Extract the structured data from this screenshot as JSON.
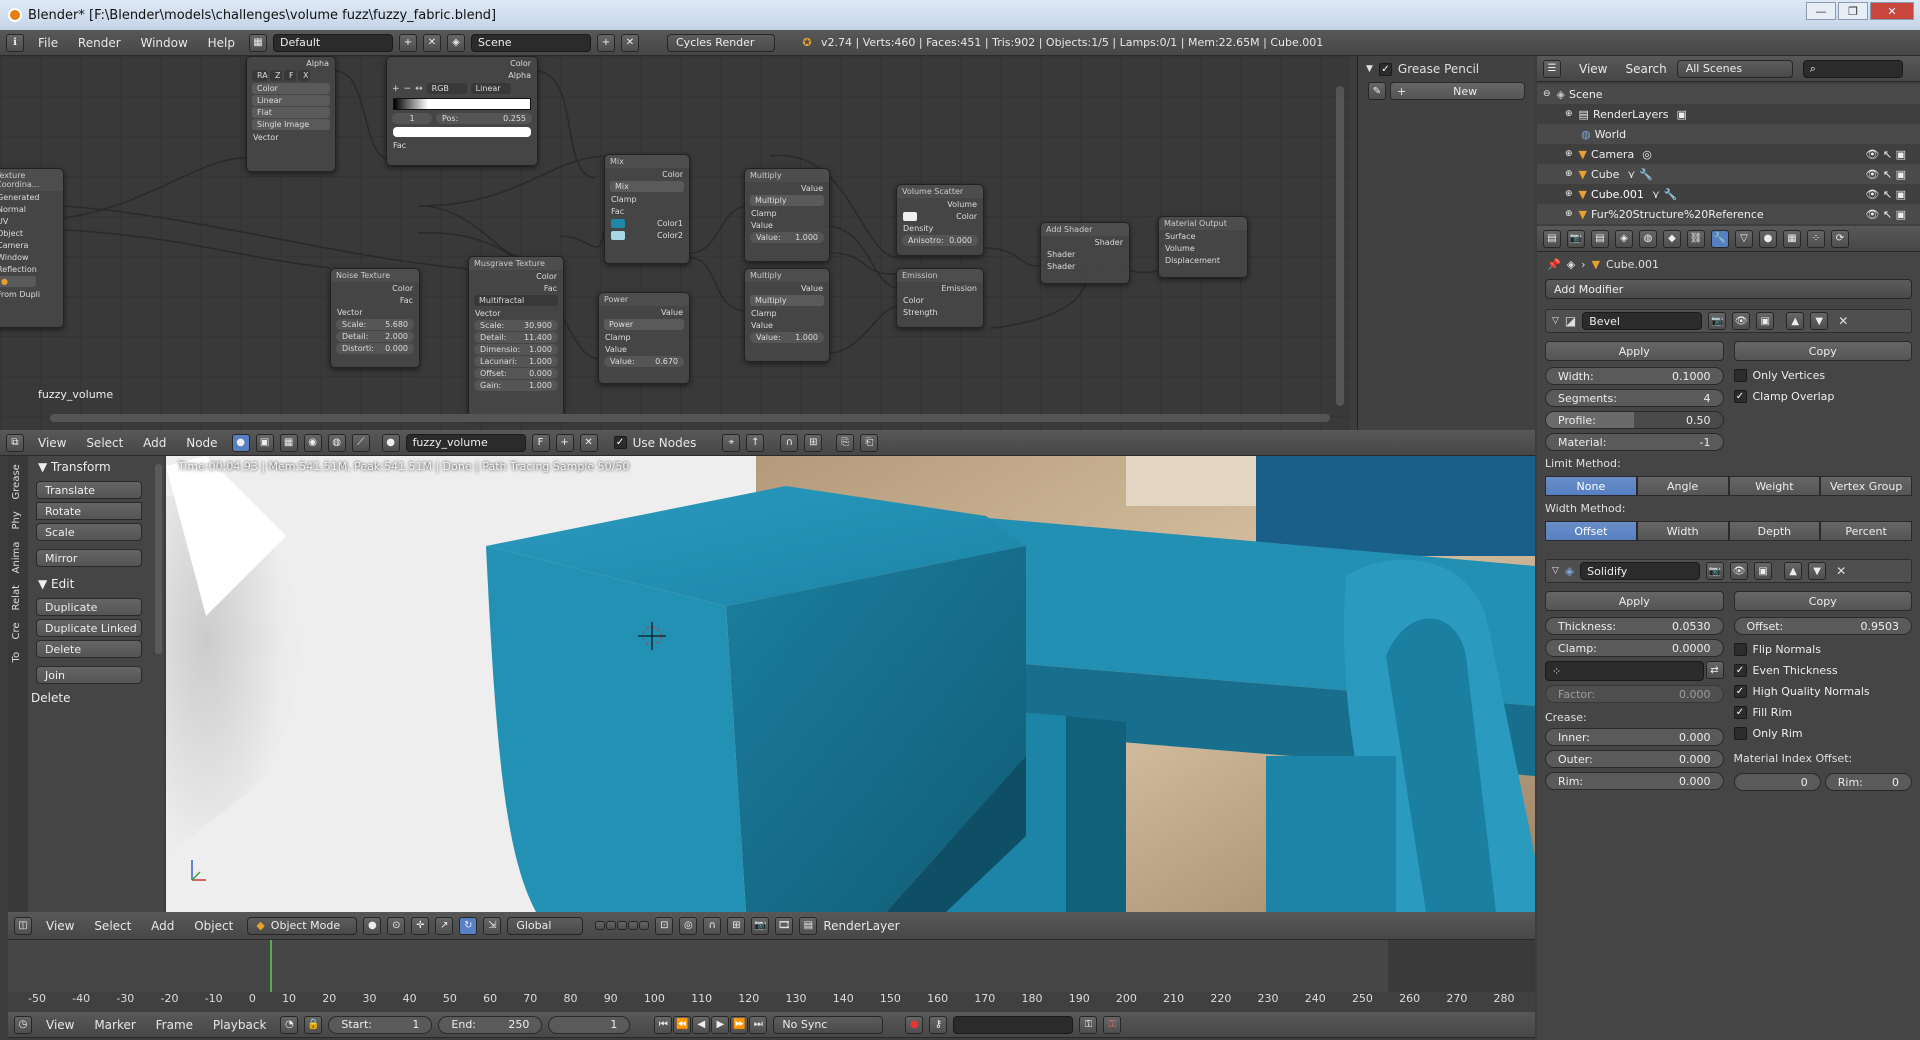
{
  "window": {
    "title": "Blender* [F:\\Blender\\models\\challenges\\volume fuzz\\fuzzy_fabric.blend]",
    "controls": [
      "—",
      "❐",
      "✕"
    ]
  },
  "topbar": {
    "menus": [
      "File",
      "Render",
      "Window",
      "Help"
    ],
    "layout": "Default",
    "scene": "Scene",
    "engine": "Cycles Render",
    "stats": "v2.74 | Verts:460 | Faces:451 | Tris:902 | Objects:1/5 | Lamps:0/1 | Mem:22.65M | Cube.001"
  },
  "node_editor": {
    "material_name": "fuzzy_volume",
    "tex_coord": {
      "title": "Texture Coordina...",
      "outputs": [
        "Generated",
        "Normal",
        "UV",
        "Object",
        "Camera",
        "Window",
        "Reflection"
      ],
      "from_dupli": "From Dupli"
    },
    "image_tex": {
      "outputs": [
        "Alpha",
        "Vector"
      ],
      "mode_buttons": [
        "RA",
        "Z",
        "F",
        "X"
      ],
      "color": "Color",
      "interp": "Linear",
      "proj": "Flat",
      "source": "Single Image"
    },
    "color_ramp": {
      "outputs": [
        "Color",
        "Alpha"
      ],
      "rgb": "RGB",
      "linear": "Linear",
      "index": "1",
      "pos": "Pos:",
      "pos_val": "0.255",
      "fac": "Fac"
    },
    "noise": {
      "title": "Noise Texture",
      "outputs": [
        "Color",
        "Fac"
      ],
      "vector": "Vector",
      "scale": "Scale:",
      "scale_v": "5.680",
      "detail": "Detail:",
      "detail_v": "2.000",
      "distort": "Distorti:",
      "distort_v": "0.000"
    },
    "musgrave": {
      "title": "Musgrave Texture",
      "outputs": [
        "Color",
        "Fac"
      ],
      "type": "Multifractal",
      "vector": "Vector",
      "fields": [
        [
          "Scale:",
          "30.900"
        ],
        [
          "Detail:",
          "11.400"
        ],
        [
          "Dimensio:",
          "1.000"
        ],
        [
          "Lacunari:",
          "1.000"
        ],
        [
          "Offset:",
          "0.000"
        ],
        [
          "Gain:",
          "1.000"
        ]
      ]
    },
    "mix": {
      "title": "Mix",
      "output": "Color",
      "mode": "Mix",
      "clamp": "Clamp",
      "fac": "Fac",
      "c1": "Color1",
      "c2": "Color2"
    },
    "power": {
      "title": "Power",
      "output": "Value",
      "mode": "Power",
      "clamp": "Clamp",
      "val": "Value",
      "val_l": "Value:",
      "val_v": "0.670"
    },
    "mult1": {
      "title": "Multiply",
      "output": "Value",
      "mode": "Multiply",
      "clamp": "Clamp",
      "val": "Value",
      "val_l": "Value:",
      "val_v": "1.000"
    },
    "mult2": {
      "title": "Multiply",
      "output": "Value",
      "mode": "Multiply",
      "clamp": "Clamp",
      "val": "Value",
      "val_l": "Value:",
      "val_v": "1.000"
    },
    "vscatter": {
      "title": "Volume Scatter",
      "output": "Volume",
      "color": "Color",
      "density": "Density",
      "aniso": "Anisotro:",
      "aniso_v": "0.000"
    },
    "emission": {
      "title": "Emission",
      "output": "Emission",
      "color": "Color",
      "strength": "Strength"
    },
    "addshader": {
      "title": "Add Shader",
      "output": "Shader",
      "in1": "Shader",
      "in2": "Shader"
    },
    "matout": {
      "title": "Material Output",
      "inputs": [
        "Surface",
        "Volume",
        "Displacement"
      ]
    }
  },
  "grease_pencil": {
    "title": "Grease Pencil",
    "new": "New"
  },
  "node_header": {
    "menus": [
      "View",
      "Select",
      "Add",
      "Node"
    ],
    "material": "fuzzy_volume",
    "fake": "F",
    "use_nodes": "Use Nodes"
  },
  "tool_shelf": {
    "tabs": [
      "To",
      "Cre",
      "Relat",
      "Anima",
      "Phy",
      "Grease"
    ],
    "transform": "Transform",
    "transform_btns": [
      "Translate",
      "Rotate",
      "Scale"
    ],
    "mirror": "Mirror",
    "edit": "Edit",
    "edit_btns": [
      "Duplicate",
      "Duplicate Linked",
      "Delete"
    ],
    "join": "Join",
    "delete_section": "Delete"
  },
  "viewport": {
    "status": "Time:00:04.93 | Mem:541.51M, Peak:541.51M | Done | Path Tracing Sample 50/50"
  },
  "view_header": {
    "menus": [
      "View",
      "Select",
      "Add",
      "Object"
    ],
    "mode": "Object Mode",
    "orientation": "Global",
    "layer": "RenderLayer"
  },
  "timeline": {
    "ticks": [
      "-50",
      "-40",
      "-30",
      "-20",
      "-10",
      "0",
      "10",
      "20",
      "30",
      "40",
      "50",
      "60",
      "70",
      "80",
      "90",
      "100",
      "110",
      "120",
      "130",
      "140",
      "150",
      "160",
      "170",
      "180",
      "190",
      "200",
      "210",
      "220",
      "230",
      "240",
      "250",
      "260",
      "270",
      "280"
    ]
  },
  "timeline_header": {
    "menus": [
      "View",
      "Marker",
      "Frame",
      "Playback"
    ],
    "start": "Start:",
    "start_v": "1",
    "end": "End:",
    "end_v": "250",
    "current": "1",
    "sync": "No Sync"
  },
  "outliner": {
    "view": "View",
    "search": "Search",
    "filter": "All Scenes",
    "items": [
      {
        "label": "Scene",
        "indent": 0
      },
      {
        "label": "RenderLayers",
        "indent": 1
      },
      {
        "label": "World",
        "indent": 1
      },
      {
        "label": "Camera",
        "indent": 1
      },
      {
        "label": "Cube",
        "indent": 1
      },
      {
        "label": "Cube.001",
        "indent": 1
      },
      {
        "label": "Fur%20Structure%20Reference",
        "indent": 1
      }
    ]
  },
  "properties": {
    "object": "Cube.001",
    "add_modifier": "Add Modifier",
    "bevel": {
      "name": "Bevel",
      "apply": "Apply",
      "copy": "Copy",
      "width": "Width:",
      "width_v": "0.1000",
      "segments": "Segments:",
      "segments_v": "4",
      "profile": "Profile:",
      "profile_v": "0.50",
      "profile_fill": 0.5,
      "material": "Material:",
      "material_v": "-1",
      "only_vertices": "Only Vertices",
      "clamp_overlap": "Clamp Overlap",
      "limit_method": "Limit Method:",
      "limit_opts": [
        "None",
        "Angle",
        "Weight",
        "Vertex Group"
      ],
      "width_method": "Width Method:",
      "width_opts": [
        "Offset",
        "Width",
        "Depth",
        "Percent"
      ]
    },
    "solidify": {
      "name": "Solidify",
      "apply": "Apply",
      "copy": "Copy",
      "thickness": "Thickness:",
      "thickness_v": "0.0530",
      "offset": "Offset:",
      "offset_v": "0.9503",
      "clamp": "Clamp:",
      "clamp_v": "0.0000",
      "flip": "Flip Normals",
      "even": "Even Thickness",
      "hq": "High Quality Normals",
      "fill": "Fill Rim",
      "only_rim": "Only Rim",
      "factor": "Factor:",
      "factor_v": "0.000",
      "crease": "Crease:",
      "inner": "Inner:",
      "inner_v": "0.000",
      "outer": "Outer:",
      "outer_v": "0.000",
      "rim": "Rim:",
      "rim_v": "0.000",
      "mat_offset": "Material Index Offset:",
      "mi_v": "0",
      "mi_rim": "Rim:",
      "mi_rim_v": "0"
    }
  },
  "colors": {
    "accent": "#5680c2",
    "fabric": "#1e88a8"
  }
}
